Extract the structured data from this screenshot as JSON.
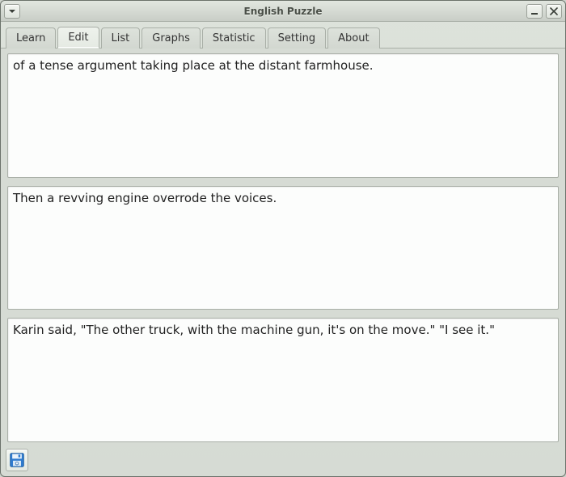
{
  "window": {
    "title": "English Puzzle"
  },
  "tabs": [
    {
      "label": "Learn",
      "active": false
    },
    {
      "label": "Edit",
      "active": true
    },
    {
      "label": "List",
      "active": false
    },
    {
      "label": "Graphs",
      "active": false
    },
    {
      "label": "Statistic",
      "active": false
    },
    {
      "label": "Setting",
      "active": false
    },
    {
      "label": "About",
      "active": false
    }
  ],
  "editor": {
    "boxes": [
      "of a tense argument taking place at the distant farmhouse.",
      "Then a revving engine overrode the voices.",
      "Karin said, \"The other truck, with the machine gun, it's on the move.\" \"I see it.\""
    ]
  },
  "icons": {
    "save": "floppy-disk-icon"
  }
}
